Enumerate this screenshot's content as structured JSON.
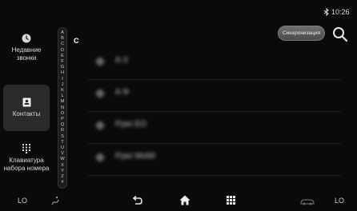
{
  "status": {
    "time": "10:26"
  },
  "header": {
    "sync_label": "Синхронизация"
  },
  "sidebar": {
    "items": [
      {
        "label": "Недавние звонки"
      },
      {
        "label": "Контакты"
      },
      {
        "label": "Клавиатура набора номера"
      }
    ]
  },
  "alphabet": [
    "A",
    "B",
    "C",
    "D",
    "E",
    "F",
    "G",
    "H",
    "I",
    "J",
    "K",
    "L",
    "M",
    "N",
    "O",
    "P",
    "Q",
    "R",
    "S",
    "T",
    "U",
    "V",
    "W",
    "X",
    "Y",
    "Z",
    "#"
  ],
  "section_letter": "C",
  "contacts": [
    {
      "name": "А З"
    },
    {
      "name": "А Ф"
    },
    {
      "name": "Руке ЕО"
    },
    {
      "name": "Руке Мобб"
    }
  ],
  "climate": {
    "temp_left": "LO",
    "temp_right": "LO"
  },
  "colors": {
    "background": "#0a0a0a",
    "selected_item": "#2a2a2a"
  }
}
